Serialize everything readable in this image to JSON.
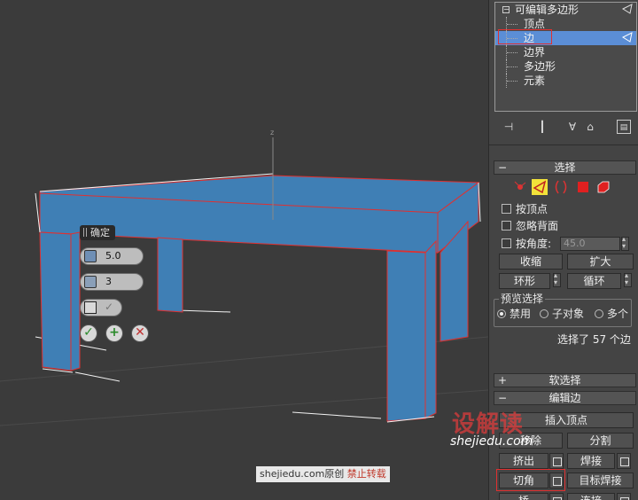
{
  "viewport": {
    "axis_label": "z",
    "caddy": {
      "title": "确定",
      "amount_value": "5.0",
      "segments_value": "3"
    }
  },
  "watermark": {
    "site": "shejiedu.com",
    "original": "原创",
    "forbid": "禁止转载",
    "logo": "设解读",
    "url": "shejiedu.com"
  },
  "stack": {
    "root": "可编辑多边形",
    "root_toggle": "−",
    "items": [
      "顶点",
      "边",
      "边界",
      "多边形",
      "元素"
    ],
    "selected_index": 1
  },
  "selection": {
    "title": "选择",
    "collapse": "−",
    "by_vertex": "按顶点",
    "ignore_backfacing": "忽略背面",
    "by_angle": "按角度:",
    "angle_value": "45.0",
    "shrink": "收缩",
    "grow": "扩大",
    "ring": "环形",
    "loop": "循环",
    "preview_title": "预览选择",
    "preview_options": [
      "禁用",
      "子对象",
      "多个"
    ],
    "preview_selected": 0,
    "status": "选择了 57 个边"
  },
  "soft_selection": {
    "title": "软选择",
    "expand": "+"
  },
  "edit_edges": {
    "title": "编辑边",
    "collapse": "−",
    "insert_vertex": "插入顶点",
    "remove": "移除",
    "split": "分割",
    "extrude": "挤出",
    "weld": "焊接",
    "chamfer": "切角",
    "target_weld": "目标焊接",
    "bridge": "桥",
    "connect": "连接"
  },
  "colors": {
    "selection_blue": "#5b8ed6",
    "highlight_red": "#e03030",
    "mesh_blue": "#3f7fb5"
  }
}
